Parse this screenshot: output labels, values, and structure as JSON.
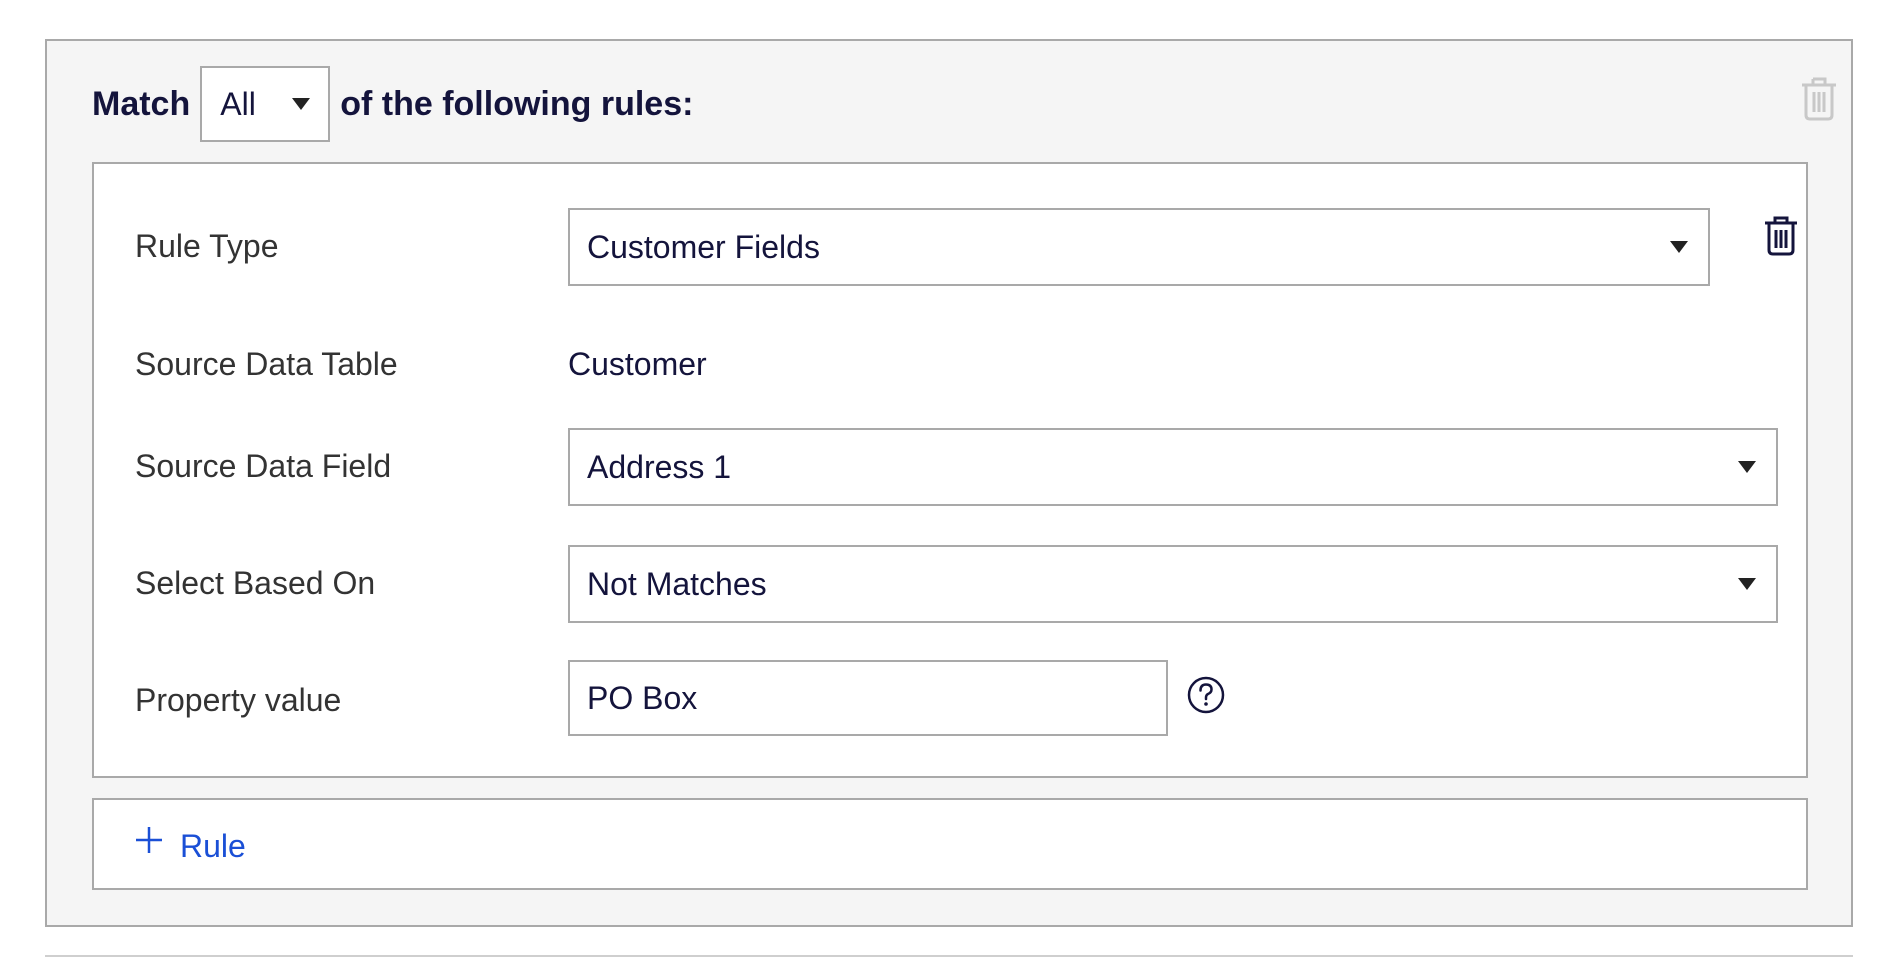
{
  "group": {
    "match_prefix": "Match",
    "match_selected": "All",
    "match_suffix": "of the following rules:"
  },
  "rule": {
    "rule_type": {
      "label": "Rule Type",
      "value": "Customer Fields"
    },
    "source_data_table": {
      "label": "Source Data Table",
      "value": "Customer"
    },
    "source_data_field": {
      "label": "Source Data Field",
      "value": "Address 1"
    },
    "select_based_on": {
      "label": "Select Based On",
      "value": "Not Matches"
    },
    "property_value": {
      "label": "Property value",
      "value": "PO Box"
    }
  },
  "add_rule": {
    "label": "Rule"
  },
  "icons": {
    "group_delete": "trash-icon",
    "rule_delete": "trash-icon",
    "help": "question-circle-icon",
    "add": "plus-icon",
    "dropdown": "caret-down-icon"
  },
  "colors": {
    "panel_bg": "#f5f5f5",
    "border": "#a9a9a9",
    "text_dark": "#14143c",
    "label_text": "#333333",
    "link_blue": "#1a4fd6",
    "disabled_icon": "#c8c8c8"
  }
}
